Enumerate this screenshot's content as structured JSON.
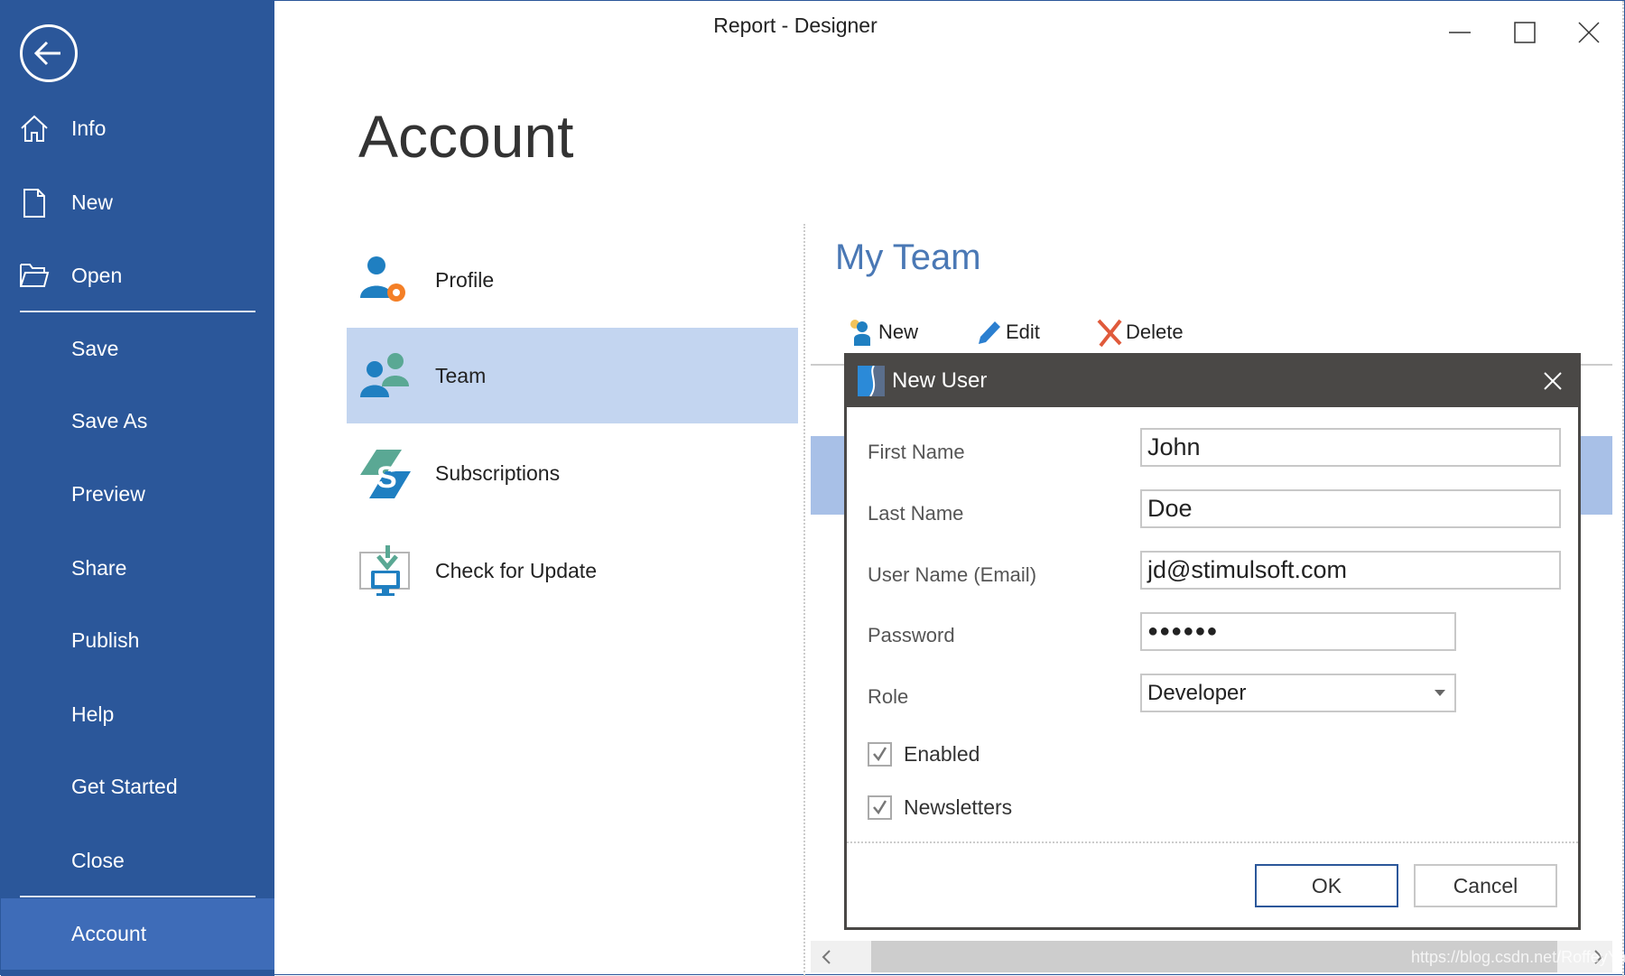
{
  "window": {
    "title": "Report - Designer"
  },
  "sidebar": {
    "items": [
      {
        "label": "Info",
        "icon": "home-icon"
      },
      {
        "label": "New",
        "icon": "file-icon"
      },
      {
        "label": "Open",
        "icon": "folder-icon"
      },
      {
        "label": "Save"
      },
      {
        "label": "Save As"
      },
      {
        "label": "Preview"
      },
      {
        "label": "Share"
      },
      {
        "label": "Publish"
      },
      {
        "label": "Help"
      },
      {
        "label": "Get Started"
      },
      {
        "label": "Close"
      },
      {
        "label": "Account",
        "active": true
      }
    ]
  },
  "page": {
    "title": "Account"
  },
  "account_nav": [
    {
      "label": "Profile"
    },
    {
      "label": "Team",
      "selected": true
    },
    {
      "label": "Subscriptions"
    },
    {
      "label": "Check for Update"
    }
  ],
  "team": {
    "title": "My Team",
    "toolbar": {
      "new": "New",
      "edit": "Edit",
      "delete": "Delete"
    }
  },
  "dialog": {
    "title": "New User",
    "fields": {
      "first_name": {
        "label": "First Name",
        "value": "John"
      },
      "last_name": {
        "label": "Last Name",
        "value": "Doe"
      },
      "email": {
        "label": "User Name (Email)",
        "value": "jd@stimulsoft.com"
      },
      "password": {
        "label": "Password",
        "value": "●●●●●●"
      },
      "role": {
        "label": "Role",
        "value": "Developer"
      }
    },
    "enabled": {
      "label": "Enabled",
      "checked": true
    },
    "newsletters": {
      "label": "Newsletters",
      "checked": true
    },
    "ok": "OK",
    "cancel": "Cancel"
  },
  "watermark": "https://blog.csdn.net/RoffeyYang",
  "colors": {
    "sidebar": "#2b579a",
    "selected": "#c3d5f0",
    "accent": "#4a78b5",
    "dialog_header": "#4a4846"
  }
}
